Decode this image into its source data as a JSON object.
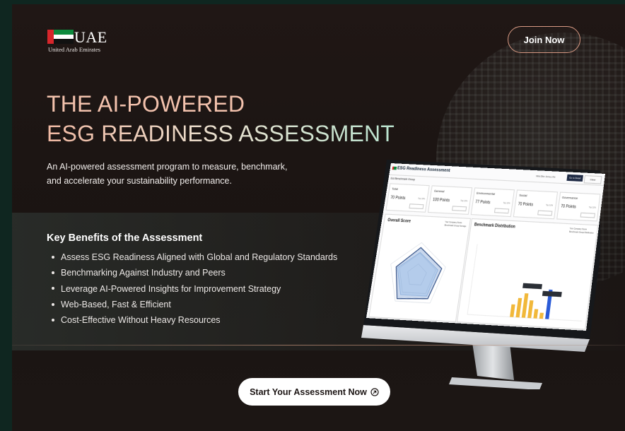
{
  "logo": {
    "word": "UAE",
    "subtitle": "United Arab Emirates"
  },
  "header": {
    "join_label": "Join Now"
  },
  "hero": {
    "title_line1": "THE AI-POWERED",
    "title_line2": "ESG READINESS ASSESSMENT",
    "intro": "An AI-powered assessment program to measure, benchmark, and accelerate your sustainability performance."
  },
  "benefits": {
    "title": "Key Benefits of the Assessment",
    "items": [
      "Assess ESG Readiness Aligned with Global and Regulatory Standards",
      "Benchmarking Against Industry and Peers",
      "Leverage AI-Powered Insights for Improvement Strategy",
      "Web-Based, Fast & Efficient",
      "Cost-Effective Without Heavy Resources"
    ]
  },
  "cta": {
    "label": "Start Your Assessment Now",
    "icon": "circle-arrow-icon"
  },
  "mockup": {
    "app_title": "ESG Readiness Assessment",
    "user": "Mild Elite Jersey Ahi",
    "btn_primary": "Go to Detail",
    "btn_secondary": "Close",
    "benchmark_group": "Esi Benchmark Group",
    "cards": [
      {
        "name": "Total",
        "points": "70 Points",
        "tag": "Top 10%"
      },
      {
        "name": "General",
        "points": "100 Points",
        "tag": "Top 10%"
      },
      {
        "name": "Environmental",
        "points": "77 Points",
        "tag": "Top 10%"
      },
      {
        "name": "Social",
        "points": "70 Points",
        "tag": "Top 10%"
      },
      {
        "name": "Governance",
        "points": "70 Points",
        "tag": "Top 10%"
      }
    ],
    "overall_title": "Overall Score",
    "overall_legend": [
      "Your Company Score",
      "Benchmark Group Average"
    ],
    "distribution_title": "Benchmark Distribution",
    "distribution_legend": [
      "Your Company Score",
      "Benchmark Group Distribution"
    ]
  },
  "colors": {
    "accent_border": "#d99a84",
    "title_peach": "#f3c2ad",
    "title_mint": "#b9e3cf",
    "flag_red": "#d7262b",
    "flag_green": "#0d8a3d"
  }
}
